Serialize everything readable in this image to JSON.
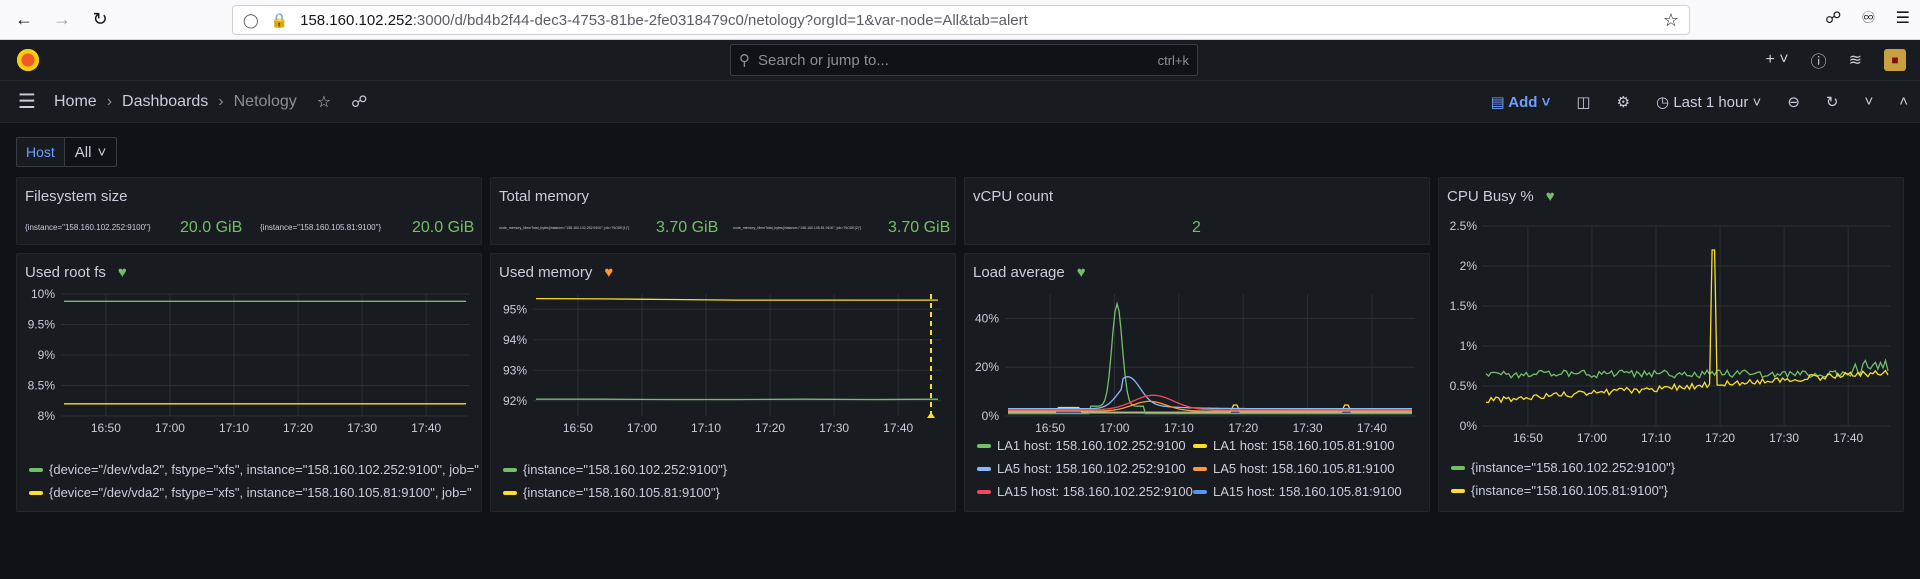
{
  "browser": {
    "url_host": "158.160.102.252",
    "url_path": ":3000/d/bd4b2f44-dec3-4753-81be-2fe0318479c0/netology?orgId=1&var-node=All&tab=alert"
  },
  "topbar": {
    "search_placeholder": "Search or jump to...",
    "search_shortcut": "ctrl+k"
  },
  "breadcrumb": {
    "home": "Home",
    "dashboards": "Dashboards",
    "current": "Netology"
  },
  "toolbar": {
    "add_label": "Add",
    "time_range": "Last 1 hour"
  },
  "variables": {
    "label": "Host",
    "value": "All"
  },
  "colors": {
    "green": "#73bf69",
    "yellow": "#fade2a",
    "orange": "#ff9830",
    "blue": "#8ab8ff",
    "red": "#f2495c",
    "darkblue": "#5794f2"
  },
  "panels": {
    "filesystem": {
      "title": "Filesystem size",
      "items": [
        {
          "label": "{instance=\"158.160.102.252:9100\"}",
          "value": "20.0 GiB"
        },
        {
          "label": "{instance=\"158.160.105.81:9100\"}",
          "value": "20.0 GiB"
        }
      ]
    },
    "total_memory": {
      "title": "Total memory",
      "items": [
        {
          "label": "node_memory_MemTotal_bytes{instance=\"158.160.102.252:9100\", job=\"NODE(1)\"}",
          "value": "3.70 GiB"
        },
        {
          "label": "node_memory_MemTotal_bytes{instance=\"158.160.105.81:9100\", job=\"NODE(2)\"}",
          "value": "3.70 GiB"
        }
      ]
    },
    "vcpu": {
      "title": "vCPU count",
      "value": "2"
    },
    "cpu_busy": {
      "title": "CPU Busy %",
      "legend": [
        "{instance=\"158.160.102.252:9100\"}",
        "{instance=\"158.160.105.81:9100\"}"
      ]
    },
    "used_root": {
      "title": "Used root fs",
      "legend": [
        "{device=\"/dev/vda2\", fstype=\"xfs\", instance=\"158.160.102.252:9100\", job=\"",
        "{device=\"/dev/vda2\", fstype=\"xfs\", instance=\"158.160.105.81:9100\", job=\""
      ]
    },
    "used_memory": {
      "title": "Used memory",
      "legend": [
        "{instance=\"158.160.102.252:9100\"}",
        "{instance=\"158.160.105.81:9100\"}"
      ]
    },
    "load_avg": {
      "title": "Load average",
      "legend": [
        "LA1 host: 158.160.102.252:9100",
        "LA1 host: 158.160.105.81:9100",
        "LA5 host: 158.160.102.252:9100",
        "LA5 host: 158.160.105.81:9100",
        "LA15 host: 158.160.102.252:9100",
        "LA15 host: 158.160.105.81:9100"
      ]
    }
  },
  "chart_data": [
    {
      "type": "line",
      "panel": "Used root fs",
      "x_ticks": [
        "16:50",
        "17:00",
        "17:10",
        "17:20",
        "17:30",
        "17:40"
      ],
      "y_ticks": [
        "10%",
        "9.5%",
        "9%",
        "8.5%",
        "8%"
      ],
      "ylim": [
        8,
        10
      ],
      "series": [
        {
          "name": "{device=\"/dev/vda2\", fstype=\"xfs\", instance=\"158.160.102.252:9100\", job=\"",
          "values": [
            9.88,
            9.88,
            9.88,
            9.88,
            9.88,
            9.88,
            9.88
          ]
        },
        {
          "name": "{device=\"/dev/vda2\", fstype=\"xfs\", instance=\"158.160.105.81:9100\", job=\"",
          "values": [
            8.2,
            8.2,
            8.2,
            8.2,
            8.2,
            8.2,
            8.2
          ]
        }
      ]
    },
    {
      "type": "line",
      "panel": "Used memory",
      "x_ticks": [
        "16:50",
        "17:00",
        "17:10",
        "17:20",
        "17:30",
        "17:40"
      ],
      "y_ticks": [
        "95%",
        "94%",
        "93%",
        "92%"
      ],
      "ylim": [
        91.5,
        95.5
      ],
      "series": [
        {
          "name": "{instance=\"158.160.102.252:9100\"}",
          "values": [
            92.05,
            92.05,
            92.04,
            92.04,
            92.05,
            92.04,
            92.05
          ]
        },
        {
          "name": "{instance=\"158.160.105.81:9100\"}",
          "values": [
            95.35,
            95.34,
            95.32,
            95.3,
            95.3,
            95.3,
            95.3
          ]
        }
      ]
    },
    {
      "type": "line",
      "panel": "Load average",
      "x_ticks": [
        "16:50",
        "17:00",
        "17:10",
        "17:20",
        "17:30",
        "17:40"
      ],
      "y_ticks": [
        "40%",
        "20%",
        "0%"
      ],
      "ylim": [
        0,
        50
      ]
    },
    {
      "type": "line",
      "panel": "CPU Busy %",
      "x_ticks": [
        "16:50",
        "17:00",
        "17:10",
        "17:20",
        "17:30",
        "17:40"
      ],
      "y_ticks": [
        "2.5%",
        "2%",
        "1.5%",
        "1%",
        "0.5%",
        "0%"
      ],
      "ylim": [
        0,
        2.5
      ]
    }
  ]
}
